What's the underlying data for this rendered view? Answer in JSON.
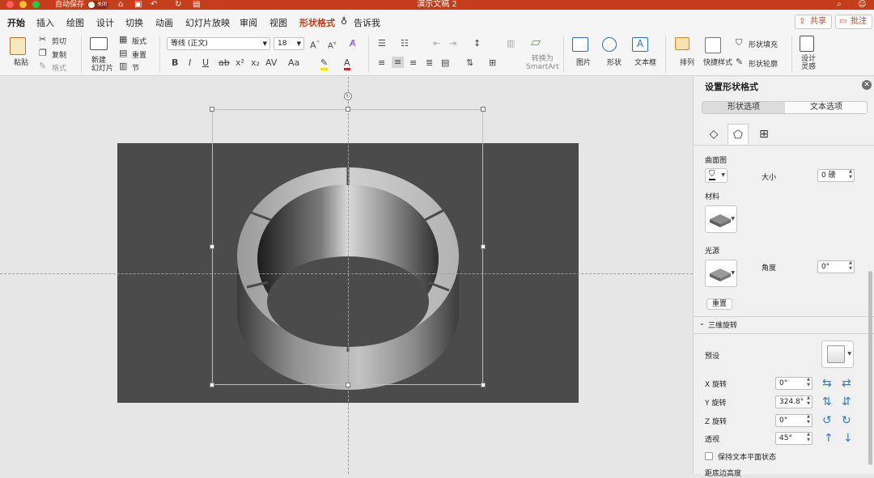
{
  "titlebar": {
    "autosave": "自动保存",
    "toggle_label": "关闭",
    "doc_title": "演示文稿 2"
  },
  "tabs": [
    "开始",
    "插入",
    "绘图",
    "设计",
    "切换",
    "动画",
    "幻灯片放映",
    "审阅",
    "视图",
    "形状格式"
  ],
  "tell_me": "告诉我",
  "share_label": "共享",
  "comment_label": "批注",
  "ribbon": {
    "paste": "粘贴",
    "cut": "剪切",
    "copy": "复制",
    "format": "格式",
    "new_slide": "新建\n幻灯片",
    "layout": "版式",
    "reset": "重置",
    "section": "节",
    "font_name": "等线 (正文)",
    "font_size": "18",
    "convert_smartart": "转换为\nSmartArt",
    "picture": "图片",
    "shape": "形状",
    "textbox": "文本框",
    "arrange": "排列",
    "quick_styles": "快捷样式",
    "shape_fill": "形状填充",
    "shape_outline": "形状轮廓",
    "design_ideas": "设计\n灵感"
  },
  "panel": {
    "title": "设置形状格式",
    "seg_shape": "形状选项",
    "seg_text": "文本选项",
    "contour_label": "曲面图",
    "size_label": "大小",
    "size_value": "0 磅",
    "material_label": "材料",
    "light_label": "光源",
    "angle_label": "角度",
    "angle_value": "0°",
    "reset_button": "重置",
    "rotation_section": "三维旋转",
    "preset_label": "预设",
    "x_rot_label": "X 旋转",
    "x_rot_value": "0°",
    "y_rot_label": "Y 旋转",
    "y_rot_value": "324.8°",
    "z_rot_label": "Z 旋转",
    "z_rot_value": "0°",
    "persp_label": "透视",
    "persp_value": "45°",
    "keep_flat_label": "保持文本平面状态",
    "cut_off_label": "距底边高度"
  },
  "colors": {
    "accent": "#c43e1c",
    "slide_bg": "#4b4b4b",
    "icon_blue": "#2f78d6"
  }
}
